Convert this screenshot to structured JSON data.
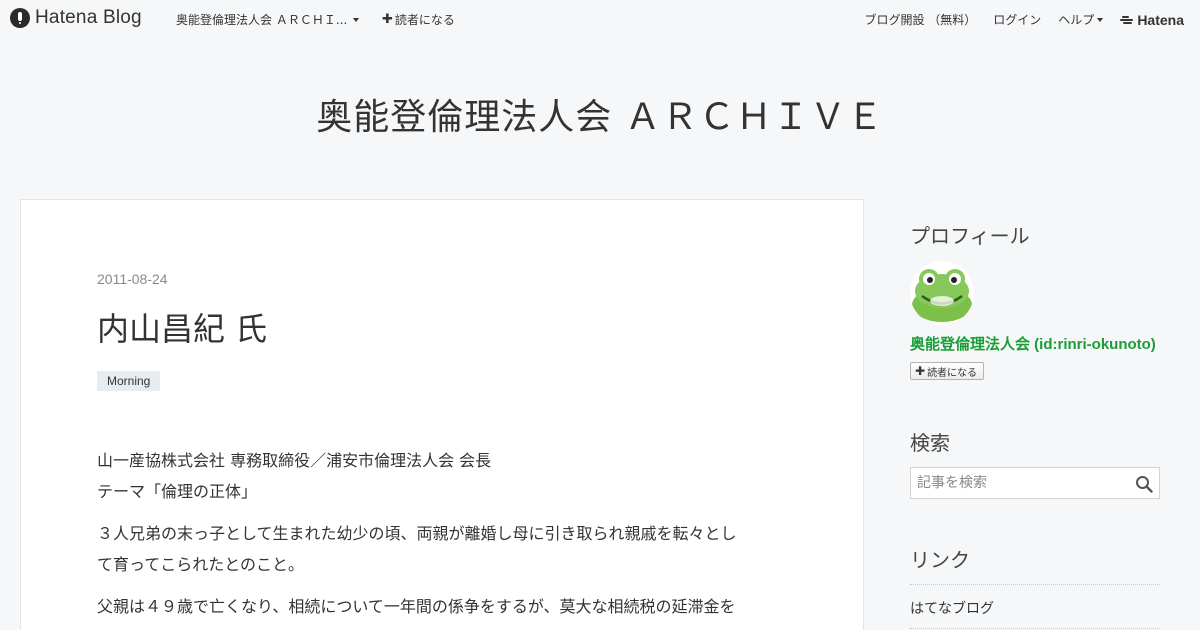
{
  "global_header": {
    "logo_text": "Hatena Blog",
    "blog_menu_label": "奥能登倫理法人会 ＡＲＣＨＩ...",
    "subscribe_label": "読者になる",
    "signup_label": "ブログ開設 （無料）",
    "login_label": "ログイン",
    "help_label": "ヘルプ",
    "hatena_label": "Hatena"
  },
  "blog": {
    "title": "奥能登倫理法人会 ＡＲＣＨＩＶＥ"
  },
  "entry": {
    "date": "2011-08-24",
    "title": "内山昌紀 氏",
    "category": "Morning",
    "paragraphs": [
      "山一産協株式会社 専務取締役／浦安市倫理法人会 会長",
      "テーマ「倫理の正体」",
      "３人兄弟の末っ子として生まれた幼少の頃、両親が離婚し母に引き取られ親戚を転々とし",
      "て育ってこられたとのこと。",
      "父親は４９歳で亡くなり、相続について一年間の係争をするが、莫大な相続税の延滞金を"
    ]
  },
  "sidebar": {
    "profile_heading": "プロフィール",
    "profile_name": "奥能登倫理法人会 (id:rinri-okunoto)",
    "profile_subscribe_label": "読者になる",
    "search_heading": "検索",
    "search_placeholder": "記事を検索",
    "links_heading": "リンク",
    "links": [
      "はてなブログ"
    ]
  },
  "colors": {
    "profile_name": "#1a9d37",
    "background": "#f6f7f8",
    "category_bg": "#e7ecf0"
  }
}
